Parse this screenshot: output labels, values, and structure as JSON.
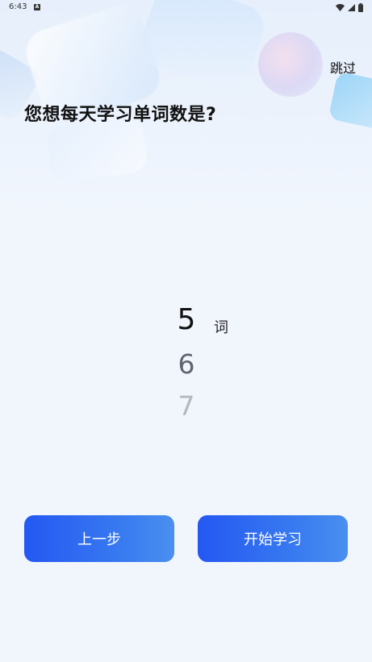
{
  "status_bar": {
    "time": "6:43",
    "notification_icon": "a-icon",
    "icons": [
      "wifi-icon",
      "signal-icon",
      "battery-icon"
    ]
  },
  "header": {
    "skip_label": "跳过",
    "question": "您想每天学习单词数是?"
  },
  "picker": {
    "selected": "5",
    "next": "6",
    "after": "7",
    "unit": "词"
  },
  "buttons": {
    "prev_label": "上一步",
    "start_label": "开始学习"
  },
  "colors": {
    "accent_start": "#2458f2",
    "accent_end": "#4a8ff0",
    "background": "#f1f6fd"
  }
}
